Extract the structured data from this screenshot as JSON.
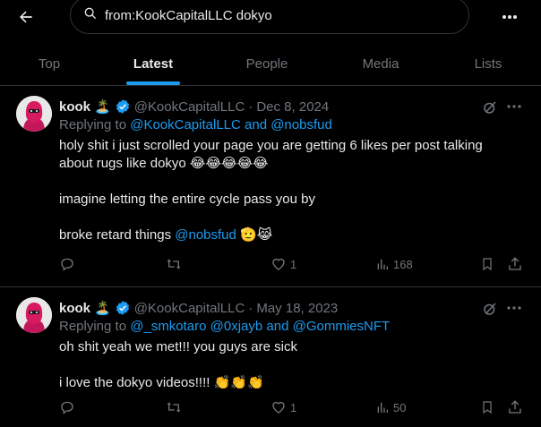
{
  "search": {
    "query": "from:KookCapitalLLC dokyo"
  },
  "tabs": [
    {
      "label": "Top"
    },
    {
      "label": "Latest"
    },
    {
      "label": "People"
    },
    {
      "label": "Media"
    },
    {
      "label": "Lists"
    }
  ],
  "active_tab": "Latest",
  "tweets": [
    {
      "name": "kook",
      "name_emoji": "🏝️",
      "handle": "@KookCapitalLLC",
      "sep": "·",
      "date": "Dec 8, 2024",
      "replying_prefix": "Replying to",
      "replying_targets": "@KookCapitalLLC and @nobsfud",
      "line1": "holy shit i just scrolled your page you are getting 6 likes per post talking",
      "line2": "about rugs like dokyo 😂😂😂😂😂",
      "line3": "imagine letting the entire cycle pass you by",
      "line4_text": "broke retard things",
      "line4_link": "@nobsfud",
      "line4_emoji": "🫡😹",
      "likes": "1",
      "views": "168"
    },
    {
      "name": "kook",
      "name_emoji": "🏝️",
      "handle": "@KookCapitalLLC",
      "sep": "·",
      "date": "May 18, 2023",
      "replying_prefix": "Replying to",
      "replying_targets": "@_smkotaro @0xjayb and @GommiesNFT",
      "line1": "oh shit yeah we met!!! you guys are sick",
      "line2": "i love the dokyo videos!!!! 👏👏👏",
      "likes": "1",
      "views": "50"
    }
  ],
  "colors": {
    "accent": "#1d9bf0",
    "muted": "#71767b",
    "text": "#e7e9ea",
    "border": "#2f3336"
  }
}
